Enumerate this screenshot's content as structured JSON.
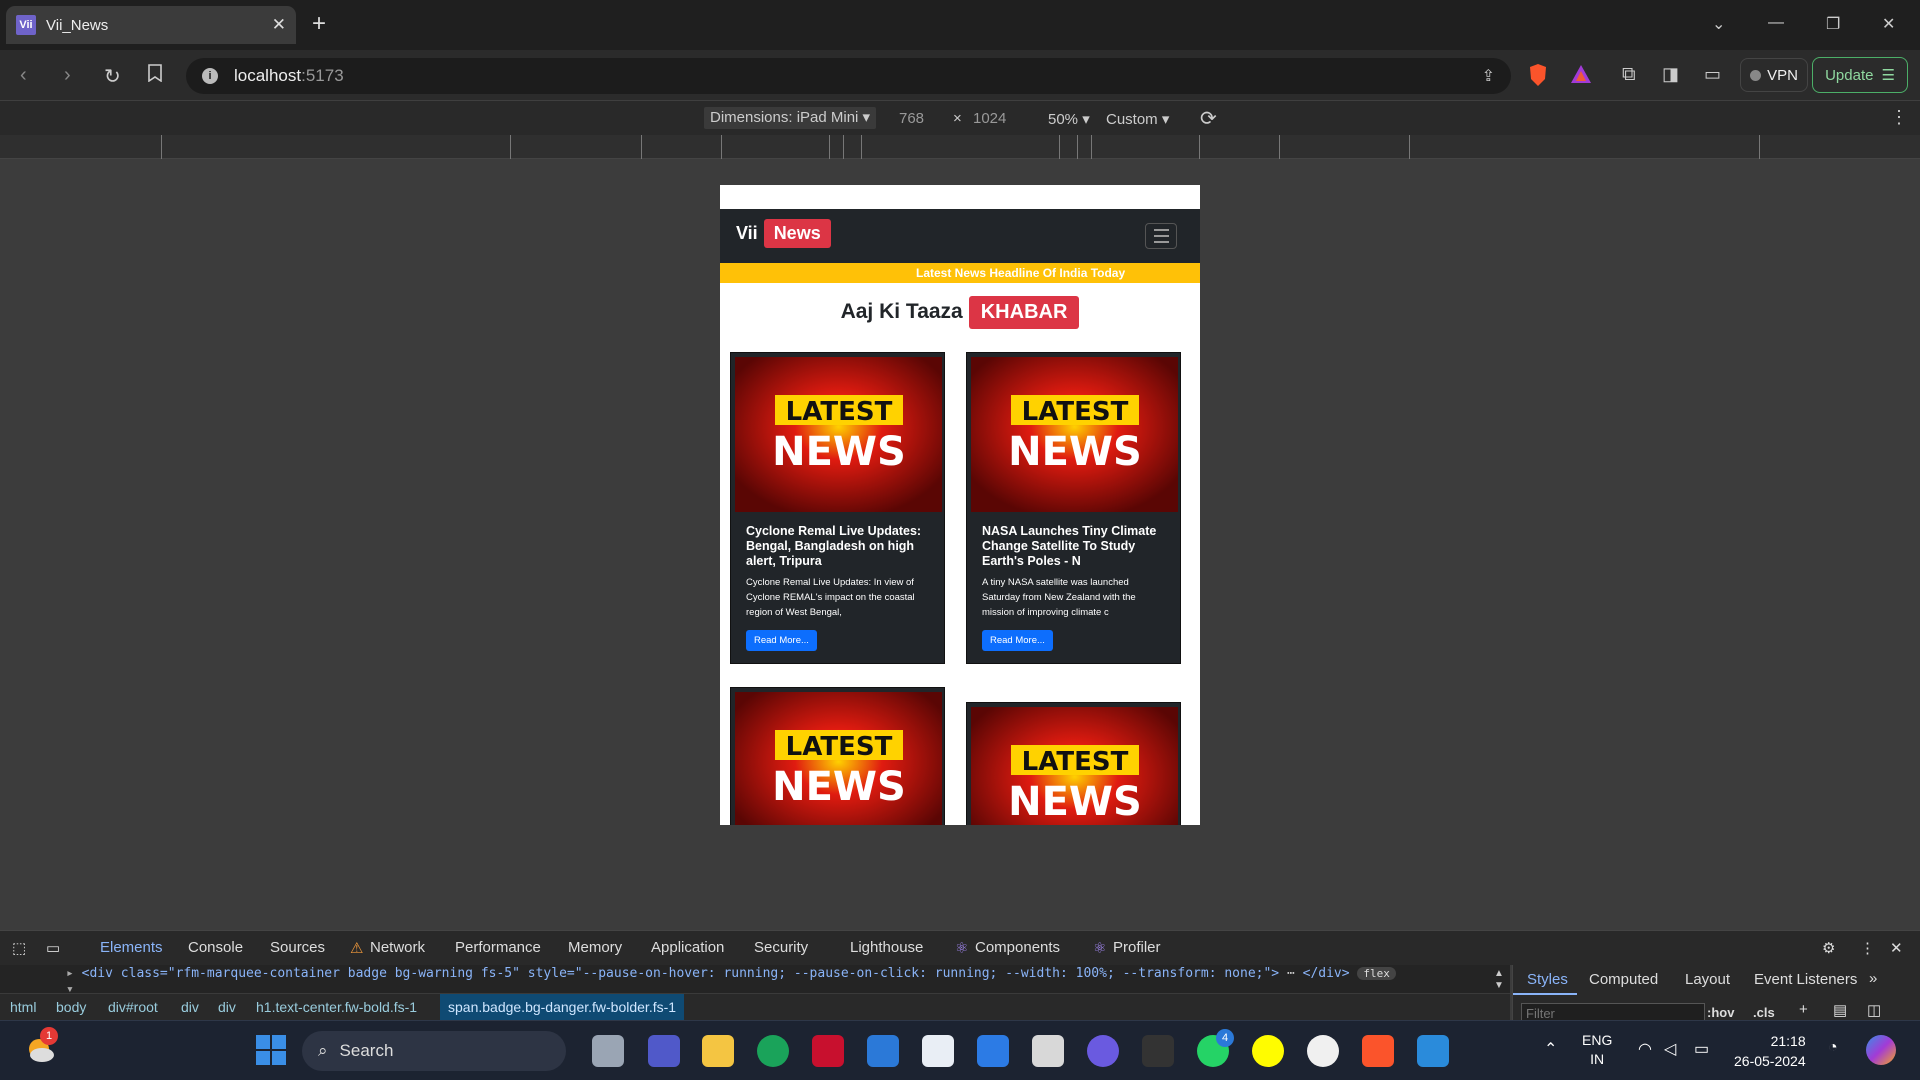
{
  "browser": {
    "tab_title": "Vii_News",
    "favicon_text": "Vii",
    "url_host": "localhost",
    "url_port": ":5173",
    "vpn_label": "VPN",
    "update_label": "Update"
  },
  "device_toolbar": {
    "dimensions_label": "Dimensions: iPad Mini",
    "width": "768",
    "height": "1024",
    "zoom": "50%",
    "throttle": "Custom"
  },
  "site": {
    "brand_vii": "Vii",
    "brand_news": "News",
    "marquee": "Latest News Headline Of India Today",
    "headline_text": "Aaj Ki Taaza",
    "headline_badge": "KHABAR",
    "cards": [
      {
        "title": "Cyclone Remal Live Updates: Bengal, Bangladesh on high alert, Tripura",
        "desc": "Cyclone Remal Live Updates: In view of Cyclone REMAL's impact on the coastal region of West Bengal,",
        "button": "Read More...",
        "img_line1": "LATEST",
        "img_line2": "NEWS"
      },
      {
        "title": "NASA Launches Tiny Climate Change Satellite To Study Earth's Poles - N",
        "desc": "A tiny NASA satellite was launched Saturday from New Zealand with the mission of improving climate c",
        "button": "Read More...",
        "img_line1": "LATEST",
        "img_line2": "NEWS"
      },
      {
        "img_line1": "LATEST",
        "img_line2": "NEWS"
      },
      {
        "img_line1": "LATEST",
        "img_line2": "NEWS"
      }
    ]
  },
  "devtools": {
    "tabs": [
      "Elements",
      "Console",
      "Sources",
      "Network",
      "Performance",
      "Memory",
      "Application",
      "Security",
      "Lighthouse",
      "Components",
      "Profiler"
    ],
    "code_line": "<div class=\"rfm-marquee-container badge bg-warning fs-5\" style=\"--pause-on-hover: running; --pause-on-click: running; --width: 100%; --transform: none;\">",
    "code_line_end": "</div>",
    "flex_badge": "flex",
    "breadcrumbs": [
      "html",
      "body",
      "div#root",
      "div",
      "div",
      "h1.text-center.fw-bold.fs-1",
      "span.badge.bg-danger.fw-bolder.fs-1"
    ],
    "side_tabs": [
      "Styles",
      "Computed",
      "Layout",
      "Event Listeners"
    ],
    "filter_placeholder": "Filter",
    "hov": ":hov",
    "cls": ".cls"
  },
  "taskbar": {
    "search_label": "Search",
    "lang_line1": "ENG",
    "lang_line2": "IN",
    "time": "21:18",
    "date": "26-05-2024",
    "weather_badge": "1",
    "whatsapp_badge": "4"
  },
  "colors": {
    "brand_red": "#dc3545",
    "marquee_yellow": "#ffc107",
    "button_blue": "#0d6efd",
    "navbar_dark": "#212529"
  }
}
